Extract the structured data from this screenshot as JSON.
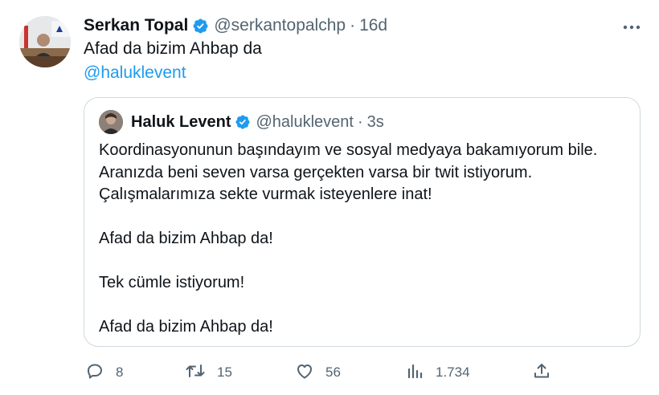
{
  "tweet": {
    "author_name": "Serkan Topal",
    "handle": "@serkantopalchp",
    "time": "16d",
    "text": "Afad da bizim Ahbap da",
    "mention": "@haluklevent"
  },
  "quoted_tweet": {
    "author_name": "Haluk Levent",
    "handle": "@haluklevent",
    "time": "3s",
    "lines": [
      "Koordinasyonunun başındayım ve sosyal medyaya bakamıyorum bile.",
      "Aranızda beni seven varsa gerçekten varsa bir twit istiyorum.",
      "Çalışmalarımıza sekte vurmak isteyenlere inat!",
      "Afad da bizim Ahbap da!",
      "Tek cümle istiyorum!",
      "Afad da bizim Ahbap da!"
    ]
  },
  "actions": {
    "reply_count": "8",
    "retweet_count": "15",
    "like_count": "56",
    "views_count": "1.734"
  },
  "icons": {
    "verified": "verified-badge-icon",
    "more": "more-options-icon",
    "reply": "reply-icon",
    "retweet": "retweet-icon",
    "like": "heart-icon",
    "views": "views-bar-chart-icon",
    "share": "share-icon"
  },
  "colors": {
    "accent": "#1d9bf0",
    "text": "#0f1419",
    "muted": "#536471",
    "border": "#cfd9de"
  }
}
